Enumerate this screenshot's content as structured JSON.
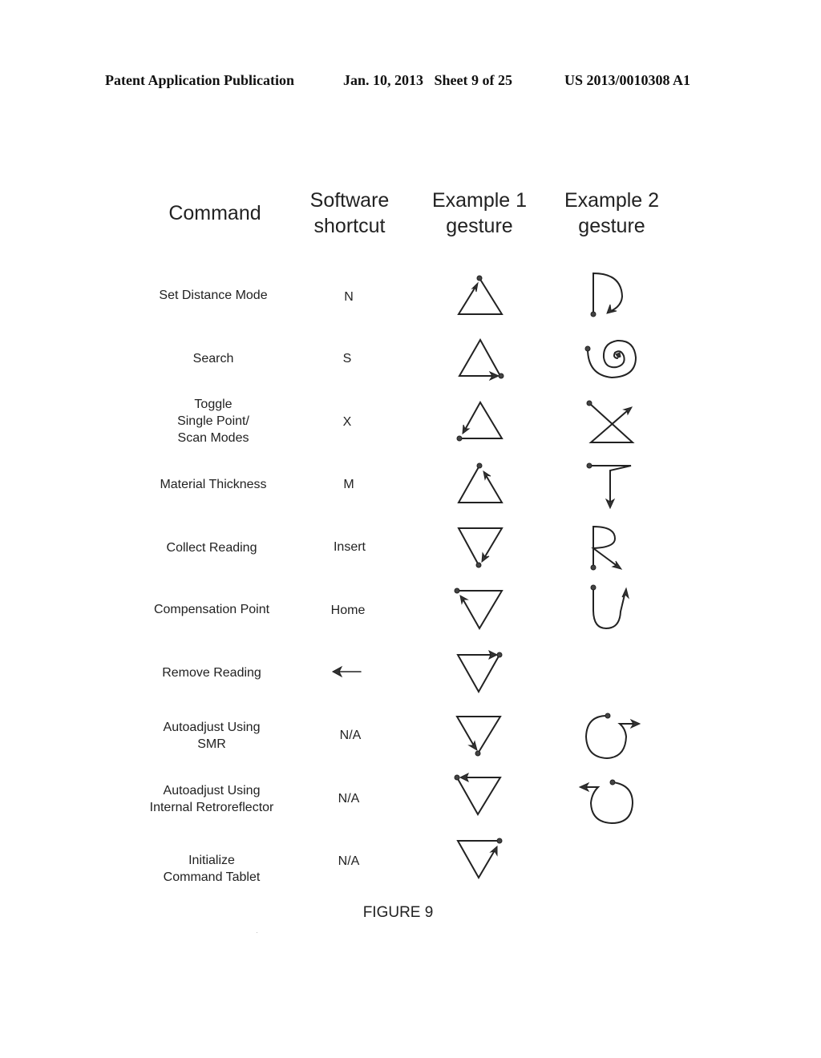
{
  "header": {
    "publication": "Patent Application Publication",
    "date_sheet": "Jan. 10, 2013   Sheet 9 of 25",
    "patent_number": "US 2013/0010308 A1"
  },
  "table": {
    "columns": [
      "Command",
      "Software\nshortcut",
      "Example 1\ngesture",
      "Example 2\ngesture"
    ],
    "rows": [
      {
        "command": "Set Distance Mode",
        "shortcut": "N",
        "gesture1": "upright-triangle-start-top-ccw-arrow",
        "gesture2": "D-shape-arc-clockwise"
      },
      {
        "command": "Search",
        "shortcut": "S",
        "gesture1": "upright-triangle-start-bottom-right-arrow",
        "gesture2": "inward-spiral"
      },
      {
        "command": "Toggle\nSingle Point/\nScan Modes",
        "shortcut": "X",
        "gesture1": "upright-triangle-start-bottom-left-arrow",
        "gesture2": "X-with-base"
      },
      {
        "command": "Material Thickness",
        "shortcut": "M",
        "gesture1": "upright-triangle-start-top-cw-arrow",
        "gesture2": "T-shape-down-arrow"
      },
      {
        "command": "Collect Reading",
        "shortcut": "Insert",
        "gesture1": "inverted-triangle-start-bottom-arrow",
        "gesture2": "R-shape"
      },
      {
        "command": "Compensation Point",
        "shortcut": "Home",
        "gesture1": "inverted-triangle-start-top-left-arrow",
        "gesture2": "U-shape-up-arrow"
      },
      {
        "command": "Remove Reading",
        "shortcut": "←",
        "gesture1": "inverted-triangle-start-top-right-arrow",
        "gesture2": ""
      },
      {
        "command": "Autoadjust Using\nSMR",
        "shortcut": "N/A",
        "gesture1": "inverted-triangle-start-bottom-cw-arrow",
        "gesture2": "circle-clockwise-right-arrow"
      },
      {
        "command": "Autoadjust Using\nInternal Retroreflector",
        "shortcut": "N/A",
        "gesture1": "inverted-triangle-start-top-left-left-arrow",
        "gesture2": "circle-counterclockwise-left-arrow"
      },
      {
        "command": "Initialize\nCommand Tablet",
        "shortcut": "N/A",
        "gesture1": "inverted-triangle-start-top-right-up-arrow",
        "gesture2": ""
      }
    ]
  },
  "caption": "FIGURE 9"
}
